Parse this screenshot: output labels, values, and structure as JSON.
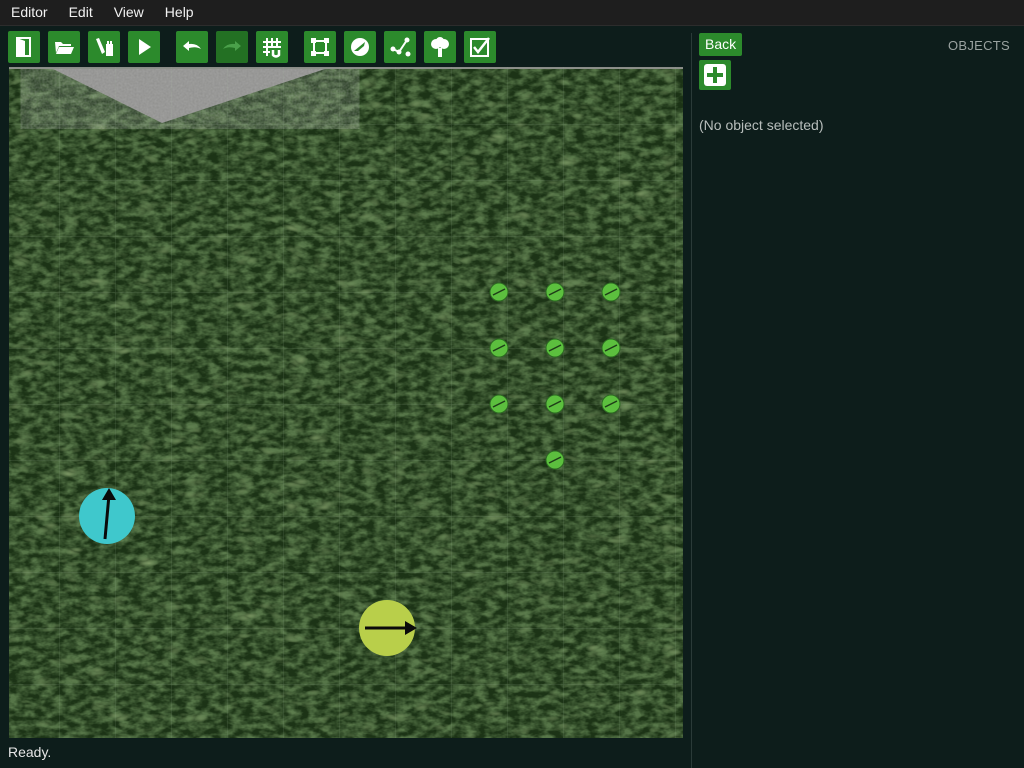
{
  "menu": [
    "Editor",
    "Edit",
    "View",
    "Help"
  ],
  "toolbar": [
    {
      "icon": "exit-door-icon",
      "disabled": false
    },
    {
      "icon": "open-folder-icon",
      "disabled": false
    },
    {
      "icon": "edit-pencil-icon",
      "disabled": false
    },
    {
      "icon": "play-icon",
      "disabled": false
    },
    {
      "icon": "undo-icon",
      "disabled": false
    },
    {
      "icon": "redo-icon",
      "disabled": true
    },
    {
      "icon": "snap-grid-icon",
      "disabled": false
    },
    {
      "icon": "shape-nodes-icon",
      "disabled": false
    },
    {
      "icon": "ball-icon",
      "disabled": false
    },
    {
      "icon": "path-icon",
      "disabled": false
    },
    {
      "icon": "tree-icon",
      "disabled": false
    },
    {
      "icon": "checkbox-icon",
      "disabled": false
    }
  ],
  "panel": {
    "back_label": "Back",
    "title": "OBJECTS",
    "no_selection": "(No object selected)"
  },
  "status": "Ready.",
  "colors": {
    "button": "#2c8a2c",
    "button_disabled": "#237023",
    "player_cyan": "#3fc8cc",
    "player_yellow": "#b9cf4a",
    "marker_green": "#5cbf3e"
  }
}
